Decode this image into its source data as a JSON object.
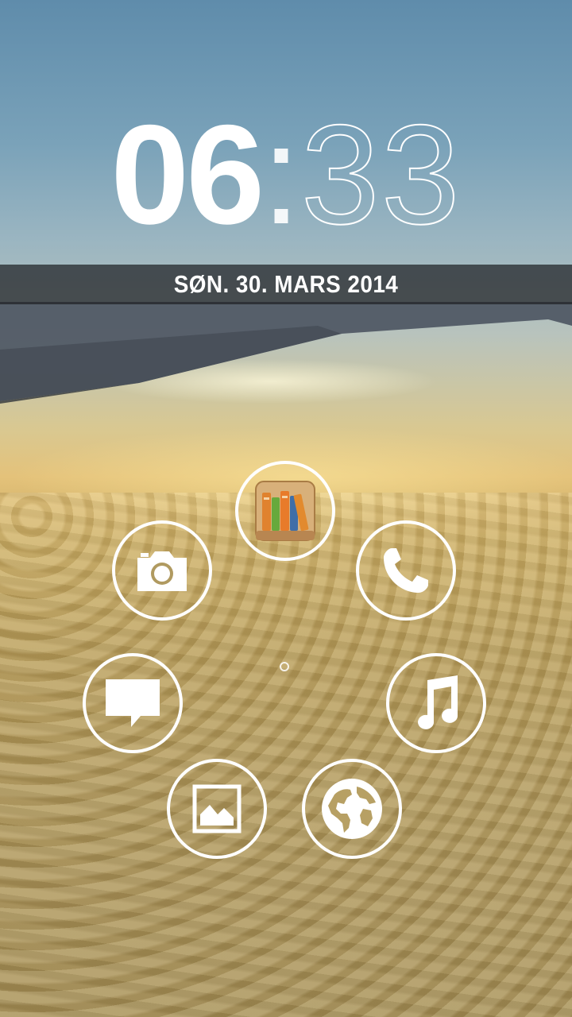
{
  "lockscreen": {
    "clock": {
      "hours": "06",
      "separator": ":",
      "minutes": "33"
    },
    "date": "SØN. 30. MARS 2014"
  },
  "shortcuts": [
    {
      "name": "library-app",
      "icon": "bookshelf-icon"
    },
    {
      "name": "camera",
      "icon": "camera-icon"
    },
    {
      "name": "phone",
      "icon": "phone-icon"
    },
    {
      "name": "messaging",
      "icon": "message-icon"
    },
    {
      "name": "music",
      "icon": "music-note-icon"
    },
    {
      "name": "gallery",
      "icon": "picture-icon"
    },
    {
      "name": "browser",
      "icon": "globe-icon"
    }
  ],
  "colors": {
    "ring": "#ffffff",
    "date_bar": "#1e2024"
  }
}
